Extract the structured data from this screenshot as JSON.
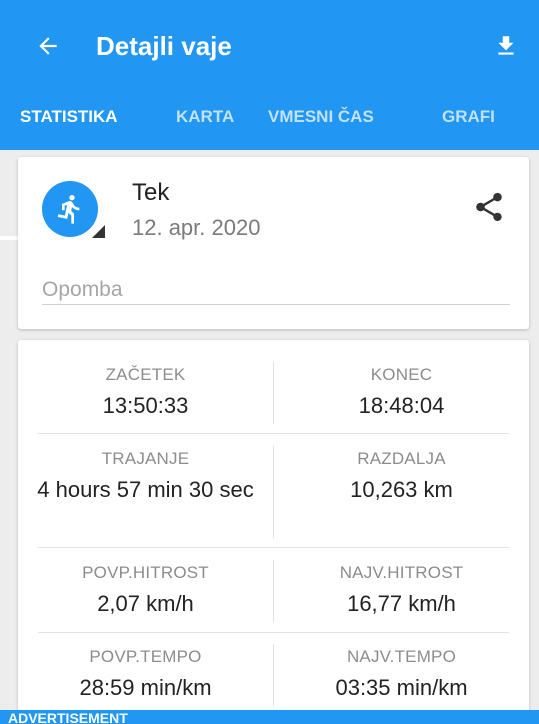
{
  "header": {
    "title": "Detajli vaje",
    "back_icon": "arrow-left-icon",
    "download_icon": "download-icon"
  },
  "tabs": [
    {
      "label": "STATISTIKA",
      "active": true
    },
    {
      "label": "KARTA",
      "active": false
    },
    {
      "label": "VMESNI ČAS",
      "active": false
    },
    {
      "label": "GRAFI",
      "active": false
    }
  ],
  "activity": {
    "icon": "running-icon",
    "name": "Tek",
    "date": "12. apr. 2020",
    "share_icon": "share-icon",
    "note_placeholder": "Opomba",
    "note_value": ""
  },
  "stats": {
    "start": {
      "label": "ZAČETEK",
      "value": "13:50:33"
    },
    "end": {
      "label": "KONEC",
      "value": "18:48:04"
    },
    "duration": {
      "label": "TRAJANJE",
      "value": "4 hours 57 min 30 sec"
    },
    "distance": {
      "label": "RAZDALJA",
      "value": "10,263 km"
    },
    "avg_speed": {
      "label": "POVP.HITROST",
      "value": "2,07 km/h"
    },
    "max_speed": {
      "label": "NAJV.HITROST",
      "value": "16,77 km/h"
    },
    "avg_pace": {
      "label": "POVP.TEMPO",
      "value": "28:59 min/km"
    },
    "max_pace": {
      "label": "NAJV.TEMPO",
      "value": "03:35 min/km"
    }
  },
  "ad": {
    "label": "ADVERTISEMENT"
  },
  "colors": {
    "primary": "#2196F3",
    "text": "#222222",
    "label": "#8c8c8c"
  }
}
